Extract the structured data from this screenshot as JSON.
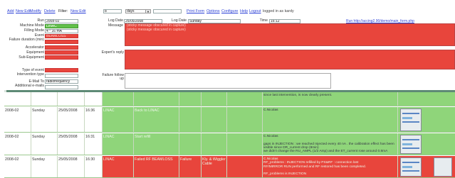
{
  "toolbar": {
    "items": [
      "Add",
      "New Edit",
      "Modify",
      "Delete",
      "Filter:",
      "New Edit"
    ],
    "filter_value": "8",
    "unit": "days",
    "print_form": "Print Form",
    "options": "Options",
    "configure": "Configure",
    "help": "Help",
    "logout": "Logout",
    "logged_in": "logged in as kardy",
    "run_link_label": "Run http://accing2.90/demo/main_form.php"
  },
  "form": {
    "run_label": "Run",
    "run_value": "2008-02",
    "log_date_label": "Log Date",
    "log_date_value": "25/05/2008",
    "log_date2_label": "Log Date",
    "log_date2_value": "Sunday",
    "time_label": "Time",
    "time_value": "16:12",
    "message_label": "Message",
    "message_lines": [
      "(sticky message obscured in capture)",
      "(sticky message obscured in capture)"
    ],
    "machine_mode_label": "Machine Mode",
    "machine_mode_value": "LINAC",
    "filling_mode_label": "Filling Mode",
    "filling_mode_value": "4 * 16 mA",
    "event_label": "Event",
    "event_value": "BEAMLOSS",
    "failure_duration_label": "Failure duration (min)",
    "failure_duration_value": "",
    "accelerator_label": "Accelerator",
    "accelerator_value": "",
    "equipment_label": "Equipment",
    "equipment_value": "",
    "sub_equipment_label": "Sub-Equipment",
    "sub_equipment_value": "",
    "experts_reply_label": "Expert's reply",
    "type_of_event_label": "Type of event",
    "type_of_event_value": "",
    "intervention_type_label": "Intervention type",
    "intervention_type_value": "",
    "email_to_label": "E-Mail To",
    "email_to_value": "radiofrequency",
    "additional_emails_label": "Additional e-mails",
    "additional_emails_value": "",
    "failure_follow_up_label": "Failure follow up"
  },
  "log_rows": [
    {
      "date": "",
      "day": "",
      "dt": "",
      "time": "",
      "mode": "",
      "subject": "",
      "c1": "",
      "c2": "",
      "c3": "",
      "comment": "since last intervention, is now clearly present.",
      "color": "green",
      "thumb": false,
      "subrow": true
    },
    {
      "date": "2008-02",
      "day": "Sunday",
      "dt": "25/05/2008",
      "time": "16:36",
      "mode": "LINAC",
      "subject": "Back to LINAC",
      "c1": "",
      "c2": "",
      "c3": "",
      "comment": "C.Nicolas",
      "color": "green",
      "thumb": true
    },
    {
      "date": "2008-02",
      "day": "Sunday",
      "dt": "25/05/2008",
      "time": "16:31",
      "mode": "LINAC",
      "subject": "Start refill",
      "c1": "",
      "c2": "",
      "c3": "",
      "comment": "C.Nicolas\n\ngaps in INJECTION : we reached Injected every 40 nA . the calibration effect has been visible since DR_current drop (8min)\nwe didn't change the RU_AMPL (1/2 Amp) and the ET_current rose around 0.8mA",
      "color": "green",
      "thumb": true
    },
    {
      "date": "2008-02",
      "day": "Sunday",
      "dt": "25/05/2008",
      "time": "16:30",
      "mode": "LINAC",
      "subject": "Failed RF BEAMLOSS",
      "c1": "Failure",
      "c2": "Kly. & Wiggler Cable",
      "c3": "",
      "comment": "C.Nicolas\nRF_problems : INJECTION refilled by PS&RF : connection lost\nRF/MIRROR RUN performed and RF restored has been completed.\n\nRF_problems is INJECTION",
      "color": "red",
      "thumb": true
    }
  ]
}
